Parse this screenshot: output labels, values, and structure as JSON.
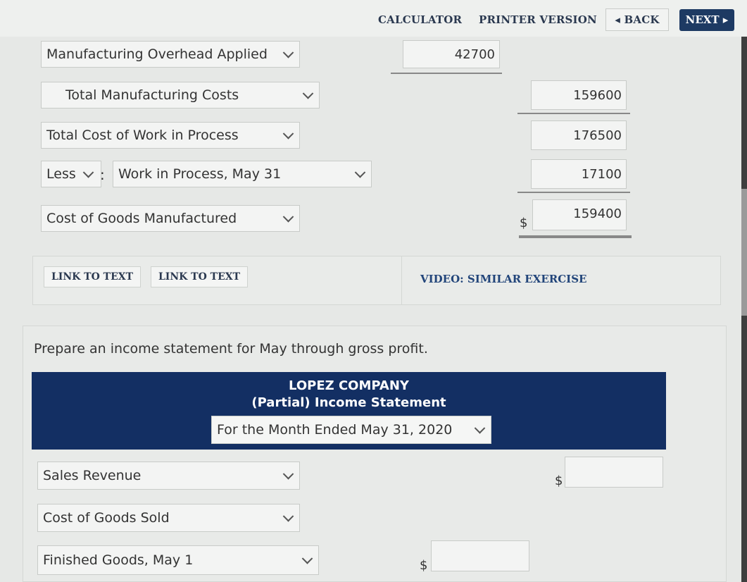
{
  "toolbar": {
    "calculator": "CALCULATOR",
    "printer_version": "PRINTER VERSION",
    "back": "◂ BACK",
    "next": "NEXT ▸"
  },
  "cogm": {
    "moh_label": "Manufacturing Overhead Applied",
    "moh_value": "42700",
    "total_mfg_label": "Total Manufacturing Costs",
    "total_mfg_value": "159600",
    "total_wip_label": "Total Cost of Work in Process",
    "total_wip_value": "176500",
    "less_label": "Less",
    "colon": ":",
    "wip_end_label": "Work in Process, May 31",
    "wip_end_value": "17100",
    "cogm_label": "Cost of Goods Manufactured",
    "cogm_value": "159400",
    "dollar": "$"
  },
  "links": {
    "link1": "LINK TO TEXT",
    "link2": "LINK TO TEXT",
    "video": "VIDEO: SIMILAR EXERCISE"
  },
  "income": {
    "prompt": "Prepare an income statement for May through gross profit.",
    "company": "LOPEZ COMPANY",
    "statement": "(Partial) Income Statement",
    "period": "For the Month Ended May 31, 2020",
    "sales_label": "Sales Revenue",
    "sales_value": "",
    "cogs_label": "Cost of Goods Sold",
    "fg_label": "Finished Goods, May 1",
    "fg_value": "",
    "dollar": "$"
  }
}
